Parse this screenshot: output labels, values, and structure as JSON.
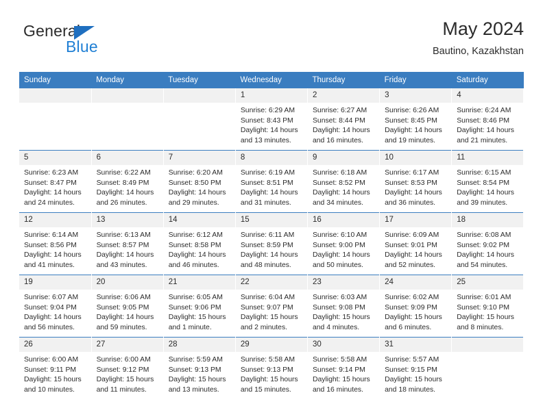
{
  "brand": {
    "name_top": "General",
    "name_bottom": "Blue",
    "accent_color": "#1f7fd4",
    "triangle_color": "#1f6fc0"
  },
  "header": {
    "title": "May 2024",
    "subtitle": "Bautino, Kazakhstan"
  },
  "theme": {
    "header_blue": "#3a7dc0",
    "daynum_band": "#f1f1f1",
    "text": "#2b2b2b"
  },
  "labels": {
    "sunrise_prefix": "Sunrise:",
    "sunset_prefix": "Sunset:",
    "daylight_prefix": "Daylight:"
  },
  "weekdays": [
    "Sunday",
    "Monday",
    "Tuesday",
    "Wednesday",
    "Thursday",
    "Friday",
    "Saturday"
  ],
  "weeks": [
    [
      {
        "day": "",
        "empty": true
      },
      {
        "day": "",
        "empty": true
      },
      {
        "day": "",
        "empty": true
      },
      {
        "day": "1",
        "sunrise": "Sunrise: 6:29 AM",
        "sunset": "Sunset: 8:43 PM",
        "daylight_line1": "Daylight: 14 hours",
        "daylight_line2": "and 13 minutes."
      },
      {
        "day": "2",
        "sunrise": "Sunrise: 6:27 AM",
        "sunset": "Sunset: 8:44 PM",
        "daylight_line1": "Daylight: 14 hours",
        "daylight_line2": "and 16 minutes."
      },
      {
        "day": "3",
        "sunrise": "Sunrise: 6:26 AM",
        "sunset": "Sunset: 8:45 PM",
        "daylight_line1": "Daylight: 14 hours",
        "daylight_line2": "and 19 minutes."
      },
      {
        "day": "4",
        "sunrise": "Sunrise: 6:24 AM",
        "sunset": "Sunset: 8:46 PM",
        "daylight_line1": "Daylight: 14 hours",
        "daylight_line2": "and 21 minutes."
      }
    ],
    [
      {
        "day": "5",
        "sunrise": "Sunrise: 6:23 AM",
        "sunset": "Sunset: 8:47 PM",
        "daylight_line1": "Daylight: 14 hours",
        "daylight_line2": "and 24 minutes."
      },
      {
        "day": "6",
        "sunrise": "Sunrise: 6:22 AM",
        "sunset": "Sunset: 8:49 PM",
        "daylight_line1": "Daylight: 14 hours",
        "daylight_line2": "and 26 minutes."
      },
      {
        "day": "7",
        "sunrise": "Sunrise: 6:20 AM",
        "sunset": "Sunset: 8:50 PM",
        "daylight_line1": "Daylight: 14 hours",
        "daylight_line2": "and 29 minutes."
      },
      {
        "day": "8",
        "sunrise": "Sunrise: 6:19 AM",
        "sunset": "Sunset: 8:51 PM",
        "daylight_line1": "Daylight: 14 hours",
        "daylight_line2": "and 31 minutes."
      },
      {
        "day": "9",
        "sunrise": "Sunrise: 6:18 AM",
        "sunset": "Sunset: 8:52 PM",
        "daylight_line1": "Daylight: 14 hours",
        "daylight_line2": "and 34 minutes."
      },
      {
        "day": "10",
        "sunrise": "Sunrise: 6:17 AM",
        "sunset": "Sunset: 8:53 PM",
        "daylight_line1": "Daylight: 14 hours",
        "daylight_line2": "and 36 minutes."
      },
      {
        "day": "11",
        "sunrise": "Sunrise: 6:15 AM",
        "sunset": "Sunset: 8:54 PM",
        "daylight_line1": "Daylight: 14 hours",
        "daylight_line2": "and 39 minutes."
      }
    ],
    [
      {
        "day": "12",
        "sunrise": "Sunrise: 6:14 AM",
        "sunset": "Sunset: 8:56 PM",
        "daylight_line1": "Daylight: 14 hours",
        "daylight_line2": "and 41 minutes."
      },
      {
        "day": "13",
        "sunrise": "Sunrise: 6:13 AM",
        "sunset": "Sunset: 8:57 PM",
        "daylight_line1": "Daylight: 14 hours",
        "daylight_line2": "and 43 minutes."
      },
      {
        "day": "14",
        "sunrise": "Sunrise: 6:12 AM",
        "sunset": "Sunset: 8:58 PM",
        "daylight_line1": "Daylight: 14 hours",
        "daylight_line2": "and 46 minutes."
      },
      {
        "day": "15",
        "sunrise": "Sunrise: 6:11 AM",
        "sunset": "Sunset: 8:59 PM",
        "daylight_line1": "Daylight: 14 hours",
        "daylight_line2": "and 48 minutes."
      },
      {
        "day": "16",
        "sunrise": "Sunrise: 6:10 AM",
        "sunset": "Sunset: 9:00 PM",
        "daylight_line1": "Daylight: 14 hours",
        "daylight_line2": "and 50 minutes."
      },
      {
        "day": "17",
        "sunrise": "Sunrise: 6:09 AM",
        "sunset": "Sunset: 9:01 PM",
        "daylight_line1": "Daylight: 14 hours",
        "daylight_line2": "and 52 minutes."
      },
      {
        "day": "18",
        "sunrise": "Sunrise: 6:08 AM",
        "sunset": "Sunset: 9:02 PM",
        "daylight_line1": "Daylight: 14 hours",
        "daylight_line2": "and 54 minutes."
      }
    ],
    [
      {
        "day": "19",
        "sunrise": "Sunrise: 6:07 AM",
        "sunset": "Sunset: 9:04 PM",
        "daylight_line1": "Daylight: 14 hours",
        "daylight_line2": "and 56 minutes."
      },
      {
        "day": "20",
        "sunrise": "Sunrise: 6:06 AM",
        "sunset": "Sunset: 9:05 PM",
        "daylight_line1": "Daylight: 14 hours",
        "daylight_line2": "and 59 minutes."
      },
      {
        "day": "21",
        "sunrise": "Sunrise: 6:05 AM",
        "sunset": "Sunset: 9:06 PM",
        "daylight_line1": "Daylight: 15 hours",
        "daylight_line2": "and 1 minute."
      },
      {
        "day": "22",
        "sunrise": "Sunrise: 6:04 AM",
        "sunset": "Sunset: 9:07 PM",
        "daylight_line1": "Daylight: 15 hours",
        "daylight_line2": "and 2 minutes."
      },
      {
        "day": "23",
        "sunrise": "Sunrise: 6:03 AM",
        "sunset": "Sunset: 9:08 PM",
        "daylight_line1": "Daylight: 15 hours",
        "daylight_line2": "and 4 minutes."
      },
      {
        "day": "24",
        "sunrise": "Sunrise: 6:02 AM",
        "sunset": "Sunset: 9:09 PM",
        "daylight_line1": "Daylight: 15 hours",
        "daylight_line2": "and 6 minutes."
      },
      {
        "day": "25",
        "sunrise": "Sunrise: 6:01 AM",
        "sunset": "Sunset: 9:10 PM",
        "daylight_line1": "Daylight: 15 hours",
        "daylight_line2": "and 8 minutes."
      }
    ],
    [
      {
        "day": "26",
        "sunrise": "Sunrise: 6:00 AM",
        "sunset": "Sunset: 9:11 PM",
        "daylight_line1": "Daylight: 15 hours",
        "daylight_line2": "and 10 minutes."
      },
      {
        "day": "27",
        "sunrise": "Sunrise: 6:00 AM",
        "sunset": "Sunset: 9:12 PM",
        "daylight_line1": "Daylight: 15 hours",
        "daylight_line2": "and 11 minutes."
      },
      {
        "day": "28",
        "sunrise": "Sunrise: 5:59 AM",
        "sunset": "Sunset: 9:13 PM",
        "daylight_line1": "Daylight: 15 hours",
        "daylight_line2": "and 13 minutes."
      },
      {
        "day": "29",
        "sunrise": "Sunrise: 5:58 AM",
        "sunset": "Sunset: 9:13 PM",
        "daylight_line1": "Daylight: 15 hours",
        "daylight_line2": "and 15 minutes."
      },
      {
        "day": "30",
        "sunrise": "Sunrise: 5:58 AM",
        "sunset": "Sunset: 9:14 PM",
        "daylight_line1": "Daylight: 15 hours",
        "daylight_line2": "and 16 minutes."
      },
      {
        "day": "31",
        "sunrise": "Sunrise: 5:57 AM",
        "sunset": "Sunset: 9:15 PM",
        "daylight_line1": "Daylight: 15 hours",
        "daylight_line2": "and 18 minutes."
      },
      {
        "day": "",
        "empty": true
      }
    ]
  ]
}
